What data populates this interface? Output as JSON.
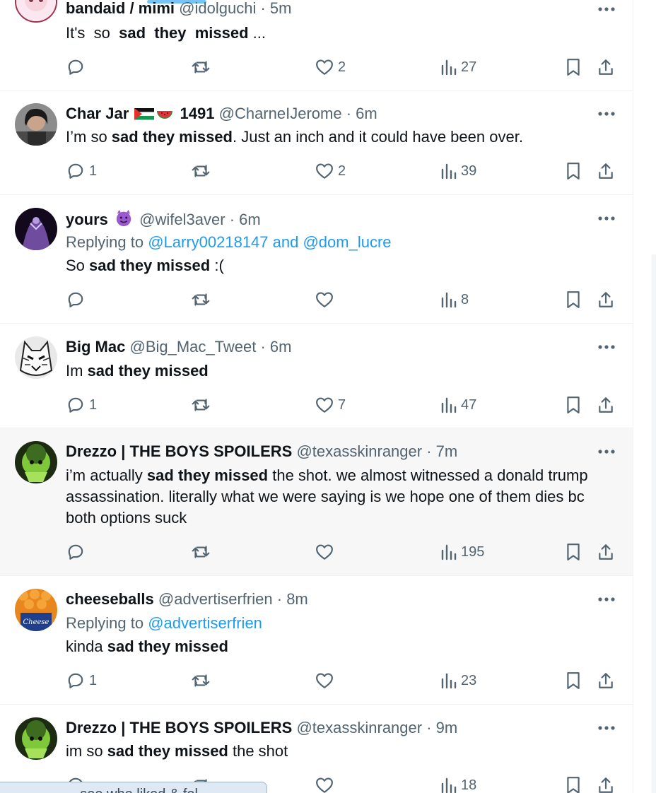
{
  "tweets": [
    {
      "name": "bandaid / mimi",
      "handle": "@idolguchi",
      "time": "5m",
      "text_prefix": "It's  so  ",
      "text_bold": "sad  they  missed",
      "text_suffix": " ...",
      "replies": "",
      "likes": "2",
      "views": "27"
    },
    {
      "name": "Char Jar",
      "name_suffix": "1491",
      "handle": "@CharneIJerome",
      "time": "6m",
      "text_prefix": "I’m so ",
      "text_bold": "sad they missed",
      "text_suffix": ". Just an inch and it could have been over.",
      "replies": "1",
      "likes": "2",
      "views": "39"
    },
    {
      "name": "yours",
      "handle": "@wifel3aver",
      "time": "6m",
      "replying_label": "Replying to ",
      "replying_to": "@Larry00218147 and @dom_lucre",
      "text_prefix": "So ",
      "text_bold": "sad they missed",
      "text_suffix": " :(",
      "replies": "",
      "likes": "",
      "views": "8"
    },
    {
      "name": "Big Mac",
      "handle": "@Big_Mac_Tweet",
      "time": "6m",
      "text_prefix": "Im ",
      "text_bold": "sad they missed",
      "text_suffix": "",
      "replies": "1",
      "likes": "7",
      "views": "47"
    },
    {
      "name": "Drezzo | THE BOYS SPOILERS",
      "handle": "@texasskinranger",
      "time": "7m",
      "text_prefix": "i’m actually ",
      "text_bold": "sad they missed",
      "text_suffix": " the shot. we almost witnessed a donald trump assassination. literally what we were saying is we hope one of them dies bc both options suck",
      "replies": "",
      "likes": "",
      "views": "195"
    },
    {
      "name": "cheeseballs",
      "handle": "@advertiserfrien",
      "time": "8m",
      "replying_label": "Replying to ",
      "replying_to": "@advertiserfrien",
      "text_prefix": "kinda ",
      "text_bold": "sad they missed",
      "text_suffix": "",
      "replies": "1",
      "likes": "",
      "views": "23"
    },
    {
      "name": "Drezzo | THE BOYS SPOILERS",
      "handle": "@texasskinranger",
      "time": "9m",
      "text_prefix": "im so ",
      "text_bold": "sad they missed",
      "text_suffix": " the shot",
      "replies": "",
      "likes": "",
      "views": "18"
    }
  ],
  "separator": "·",
  "toast_text": "... see who liked & fol..."
}
